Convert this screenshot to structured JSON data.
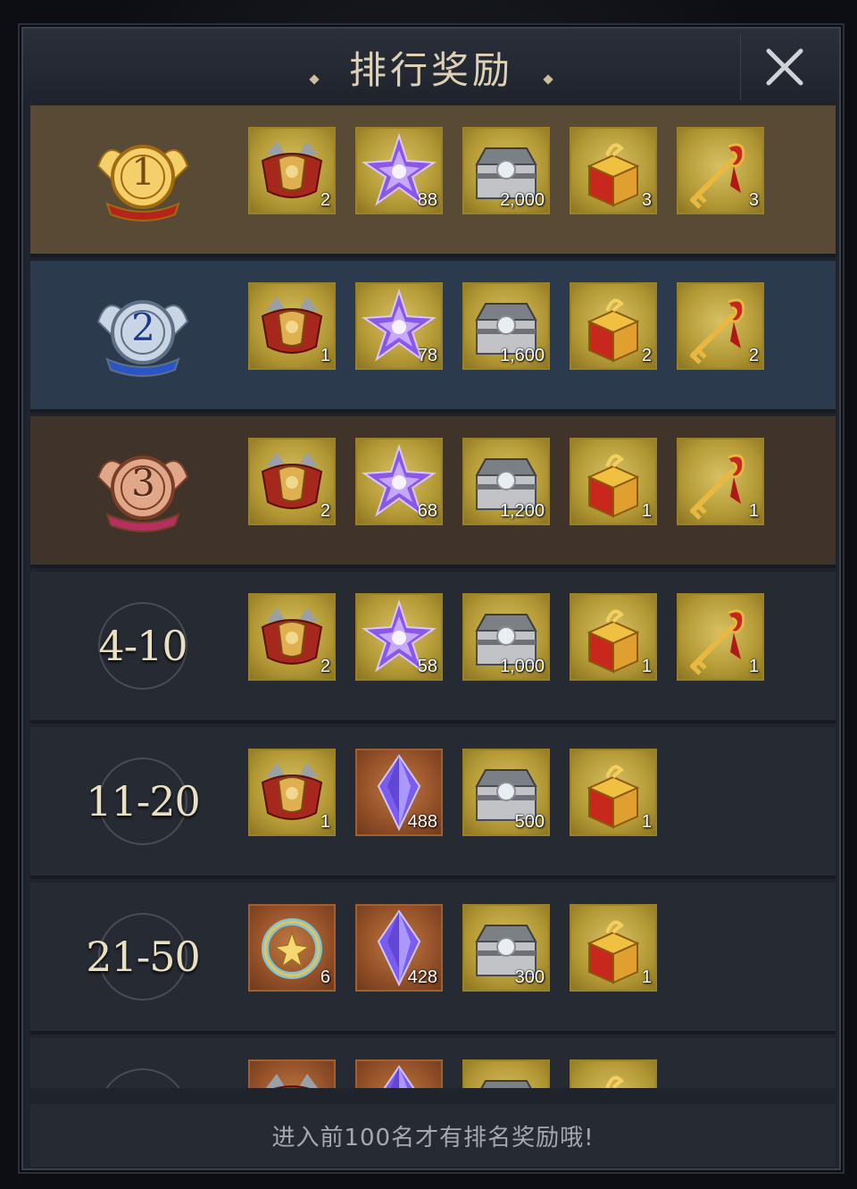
{
  "title": "排行奖励",
  "footer_note": "进入前100名才有排名奖励哦!",
  "colors": {
    "row_first": "#584a34",
    "row_second": "#2b3a4c",
    "row_third": "#40342a",
    "row_default": "#262a33",
    "title": "#ded1b6"
  },
  "rows": [
    {
      "rank": "1",
      "badge": "gold-rank-1-emblem",
      "style": "first",
      "items": [
        {
          "icon": "armor-chest-icon",
          "qty": "2",
          "bg": "gold"
        },
        {
          "icon": "purple-crystal-icon",
          "qty": "88",
          "bg": "gold"
        },
        {
          "icon": "silver-chest-icon",
          "qty": "2,000",
          "bg": "gold"
        },
        {
          "icon": "gold-treasure-box-icon",
          "qty": "3",
          "bg": "gold"
        },
        {
          "icon": "dragon-key-icon",
          "qty": "3",
          "bg": "gold"
        }
      ]
    },
    {
      "rank": "2",
      "badge": "silver-rank-2-emblem",
      "style": "second",
      "items": [
        {
          "icon": "armor-chest-icon",
          "qty": "1",
          "bg": "gold"
        },
        {
          "icon": "purple-crystal-icon",
          "qty": "78",
          "bg": "gold"
        },
        {
          "icon": "silver-chest-icon",
          "qty": "1,600",
          "bg": "gold"
        },
        {
          "icon": "gold-treasure-box-icon",
          "qty": "2",
          "bg": "gold"
        },
        {
          "icon": "dragon-key-icon",
          "qty": "2",
          "bg": "gold"
        }
      ]
    },
    {
      "rank": "3",
      "badge": "bronze-rank-3-emblem",
      "style": "third",
      "items": [
        {
          "icon": "armor-chest-icon",
          "qty": "2",
          "bg": "gold"
        },
        {
          "icon": "purple-crystal-icon",
          "qty": "68",
          "bg": "gold"
        },
        {
          "icon": "silver-chest-icon",
          "qty": "1,200",
          "bg": "gold"
        },
        {
          "icon": "gold-treasure-box-icon",
          "qty": "1",
          "bg": "gold"
        },
        {
          "icon": "dragon-key-icon",
          "qty": "1",
          "bg": "gold"
        }
      ]
    },
    {
      "rank": "4-10",
      "style": "default",
      "items": [
        {
          "icon": "armor-chest-icon",
          "qty": "2",
          "bg": "gold"
        },
        {
          "icon": "purple-crystal-icon",
          "qty": "58",
          "bg": "gold"
        },
        {
          "icon": "silver-chest-icon",
          "qty": "1,000",
          "bg": "gold"
        },
        {
          "icon": "gold-treasure-box-icon",
          "qty": "1",
          "bg": "gold"
        },
        {
          "icon": "dragon-key-icon",
          "qty": "1",
          "bg": "gold"
        }
      ]
    },
    {
      "rank": "11-20",
      "style": "default",
      "items": [
        {
          "icon": "armor-chest-icon",
          "qty": "1",
          "bg": "gold"
        },
        {
          "icon": "violet-shard-icon",
          "qty": "488",
          "bg": "orange"
        },
        {
          "icon": "silver-chest-icon",
          "qty": "500",
          "bg": "gold"
        },
        {
          "icon": "gold-treasure-box-icon",
          "qty": "1",
          "bg": "gold"
        }
      ]
    },
    {
      "rank": "21-50",
      "style": "default",
      "items": [
        {
          "icon": "jade-ring-icon",
          "qty": "6",
          "bg": "orange"
        },
        {
          "icon": "violet-shard-icon",
          "qty": "428",
          "bg": "orange"
        },
        {
          "icon": "silver-chest-icon",
          "qty": "300",
          "bg": "gold"
        },
        {
          "icon": "gold-treasure-box-icon",
          "qty": "1",
          "bg": "gold"
        }
      ]
    },
    {
      "rank": "",
      "style": "default",
      "items": [
        {
          "icon": "armor-chest-icon",
          "qty": "",
          "bg": "orange"
        },
        {
          "icon": "violet-shard-icon",
          "qty": "",
          "bg": "orange"
        },
        {
          "icon": "silver-chest-icon",
          "qty": "",
          "bg": "gold"
        },
        {
          "icon": "gold-treasure-box-icon",
          "qty": "",
          "bg": "gold"
        }
      ]
    }
  ]
}
